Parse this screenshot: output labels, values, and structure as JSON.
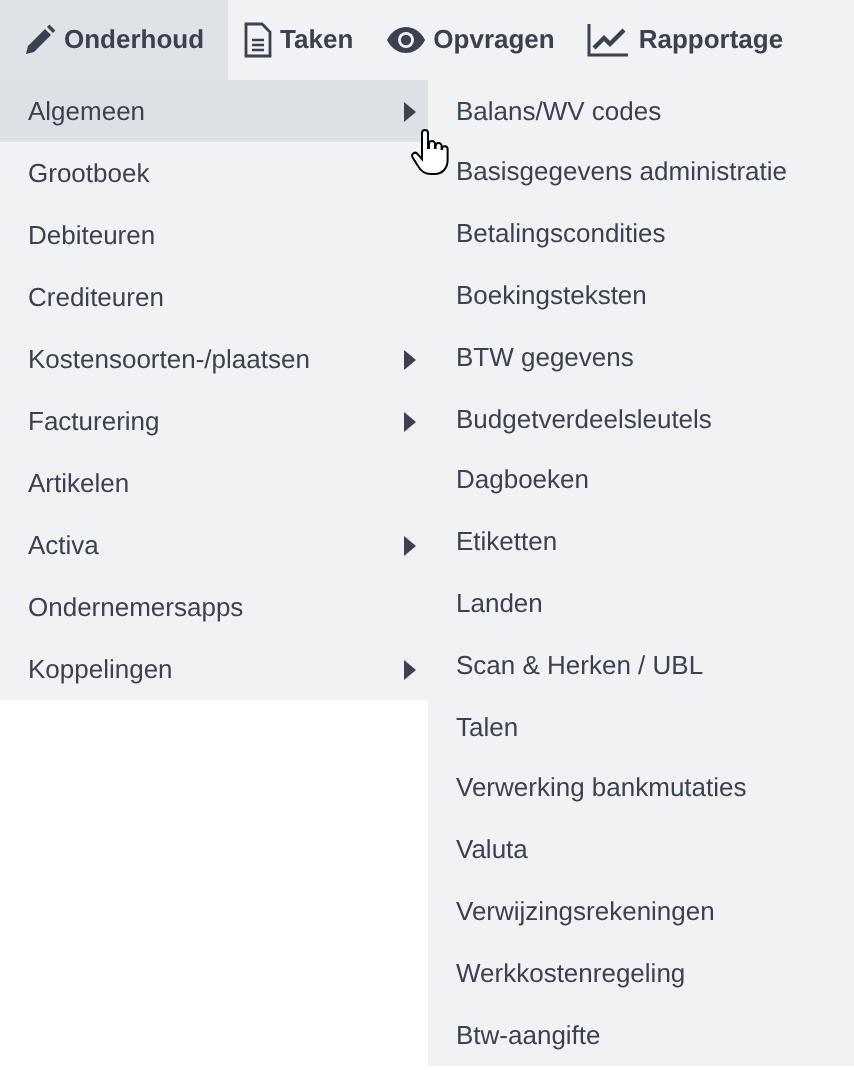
{
  "menu_bar": [
    {
      "label": "Onderhoud",
      "selected": true
    },
    {
      "label": "Taken",
      "selected": false
    },
    {
      "label": "Opvragen",
      "selected": false
    },
    {
      "label": "Rapportage",
      "selected": false
    }
  ],
  "menu": [
    {
      "label": "Algemeen",
      "has_submenu": true,
      "selected": true
    },
    {
      "label": "Grootboek",
      "has_submenu": false,
      "selected": false
    },
    {
      "label": "Debiteuren",
      "has_submenu": false,
      "selected": false
    },
    {
      "label": "Crediteuren",
      "has_submenu": false,
      "selected": false
    },
    {
      "label": "Kostensoorten-/plaatsen",
      "has_submenu": true,
      "selected": false
    },
    {
      "label": "Facturering",
      "has_submenu": true,
      "selected": false
    },
    {
      "label": "Artikelen",
      "has_submenu": false,
      "selected": false
    },
    {
      "label": "Activa",
      "has_submenu": true,
      "selected": false
    },
    {
      "label": "Ondernemersapps",
      "has_submenu": false,
      "selected": false
    },
    {
      "label": "Koppelingen",
      "has_submenu": true,
      "selected": false
    }
  ],
  "submenu": [
    "Balans/WV codes",
    "Basisgegevens administratie",
    "Betalingscondities",
    "Boekingsteksten",
    "BTW gegevens",
    "Budgetverdeelsleutels",
    "Dagboeken",
    "Etiketten",
    "Landen",
    "Scan & Herken / UBL",
    "Talen",
    "Verwerking bankmutaties",
    "Valuta",
    "Verwijzingsrekeningen",
    "Werkkostenregeling",
    "Btw-aangifte"
  ]
}
